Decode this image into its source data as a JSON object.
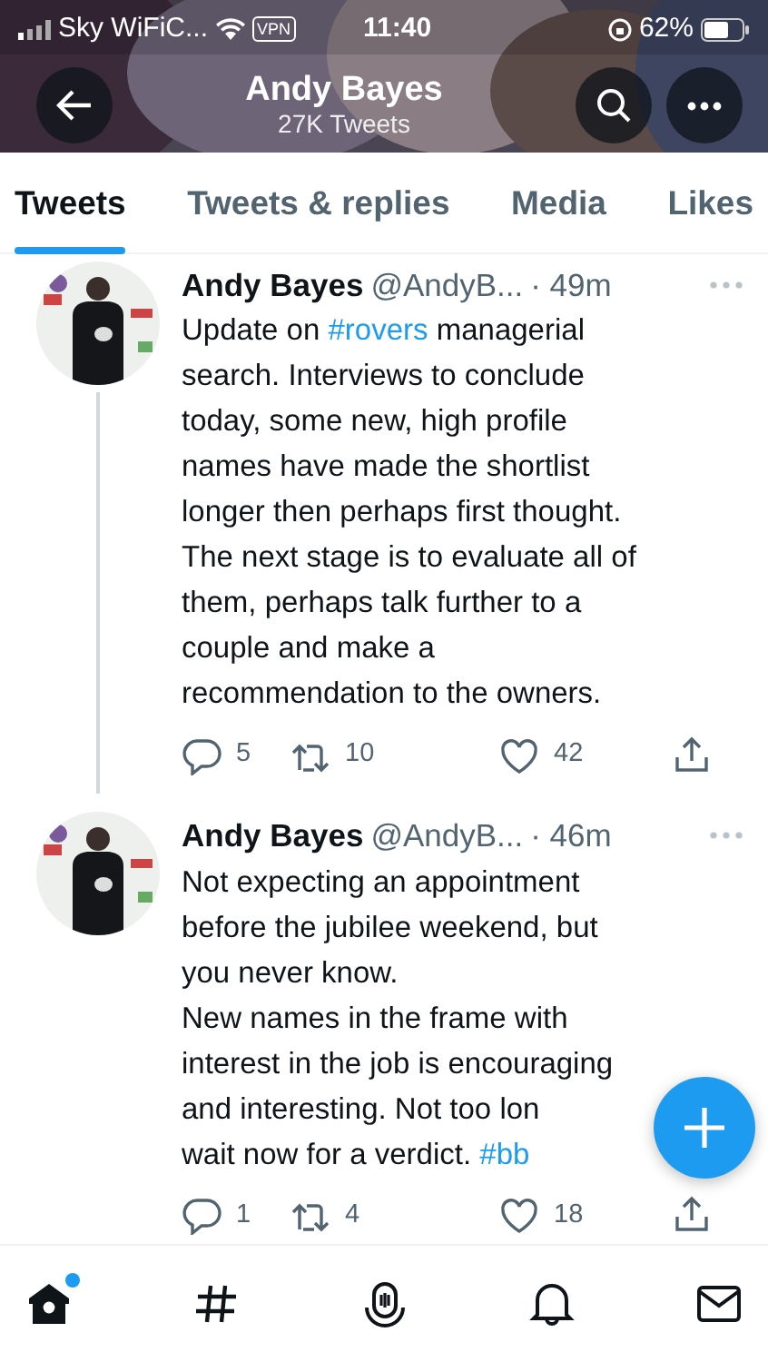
{
  "status_bar": {
    "carrier": "Sky WiFiC...",
    "vpn": "VPN",
    "time": "11:40",
    "battery": "62%"
  },
  "header": {
    "title": "Andy Bayes",
    "subtitle": "27K Tweets"
  },
  "tabs": [
    {
      "label": "Tweets",
      "selected": true
    },
    {
      "label": "Tweets & replies",
      "selected": false
    },
    {
      "label": "Media",
      "selected": false
    },
    {
      "label": "Likes",
      "selected": false
    }
  ],
  "tweets": [
    {
      "name": "Andy Bayes",
      "handle": "@AndyB...",
      "time": "· 49m",
      "thread": true,
      "body": [
        {
          "text": "Update on "
        },
        {
          "text": "#rovers",
          "kind": "hashtag"
        },
        {
          "text": " managerial search. Interviews to conclude today, some new, high profile names have made the shortlist longer then perhaps first thought. The next stage is to evaluate all of them, perhaps talk further to a couple and make a recommendation to the owners."
        }
      ],
      "replies": "5",
      "retweets": "10",
      "likes": "42"
    },
    {
      "name": "Andy Bayes",
      "handle": "@AndyB...",
      "time": "· 46m",
      "thread": false,
      "body": [
        {
          "text": "Not expecting an appointment before the jubilee weekend, but you never know.\nNew names in the frame with interest in the job is encouraging and interesting. Not too lon\nwait now for a verdict. "
        },
        {
          "text": "#bb",
          "kind": "hashtag"
        }
      ],
      "replies": "1",
      "retweets": "4",
      "likes": "18"
    }
  ],
  "nav": [
    {
      "kind": "home",
      "selected": true,
      "dot": true
    },
    {
      "kind": "explore",
      "selected": false,
      "dot": false
    },
    {
      "kind": "spaces",
      "selected": false,
      "dot": false
    },
    {
      "kind": "notifications",
      "selected": false,
      "dot": false
    },
    {
      "kind": "messages",
      "selected": false,
      "dot": false
    }
  ]
}
